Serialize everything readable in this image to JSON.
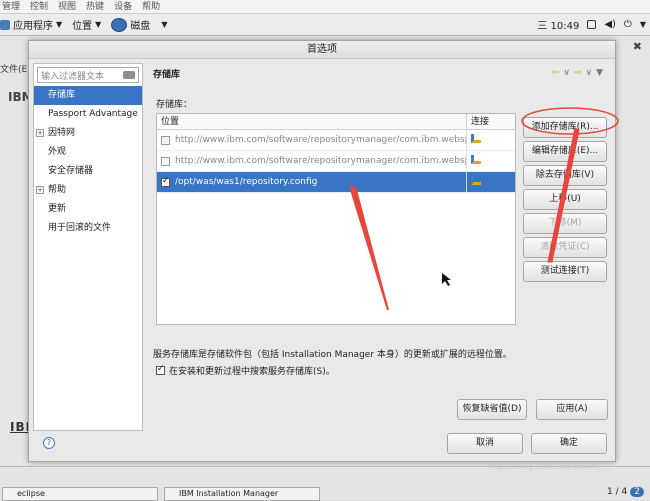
{
  "vm_menu": [
    "管理",
    "控制",
    "视图",
    "热键",
    "设备",
    "帮助"
  ],
  "top_panel": {
    "apps": "应用程序",
    "places": "位置",
    "disk": "磁盘",
    "time": "三 10:49"
  },
  "background": {
    "file_menu": "文件(E",
    "ibm": "IBM",
    "ibm_logo": "IBM"
  },
  "dialog": {
    "title": "首选项",
    "filter_placeholder": "输入过滤器文本",
    "nav": [
      "存储库",
      "Passport Advantage",
      "因特网",
      "外观",
      "安全存储器",
      "帮助",
      "更新",
      "用于回滚的文件"
    ],
    "section_title": "存储库",
    "repos_label": "存储库：",
    "table": {
      "col_location": "位置",
      "col_connection": "连接",
      "rows": [
        {
          "location": "http://www.ibm.com/software/repositorymanager/com.ibm.websphere",
          "checked": false,
          "selected": false
        },
        {
          "location": "http://www.ibm.com/software/repositorymanager/com.ibm.websphere",
          "checked": false,
          "selected": false
        },
        {
          "location": "/opt/was/was1/repository.config",
          "checked": true,
          "selected": true
        }
      ]
    },
    "buttons": {
      "add": "添加存储库(R)...",
      "edit": "编辑存储库(E)...",
      "remove": "除去存储库(V)",
      "up": "上移(U)",
      "down": "下移(M)",
      "clear": "清除凭证(C)",
      "test": "测试连接(T)",
      "restore": "恢复缺省值(D)",
      "apply": "应用(A)",
      "cancel": "取消",
      "ok": "确定"
    },
    "info_text": "服务存储库是存储软件包（包括 Installation Manager 本身）的更新或扩展的远程位置。",
    "search_checkbox": "在安装和更新过程中搜索服务存储库(S)。",
    "search_checked": true
  },
  "taskbar": {
    "eclipse": "eclipse",
    "installation_manager": "IBM Installation Manager",
    "pager": "1 / 4",
    "pager_badge": "2"
  },
  "watermark": "https://blog.csdn.net/weixin_..."
}
